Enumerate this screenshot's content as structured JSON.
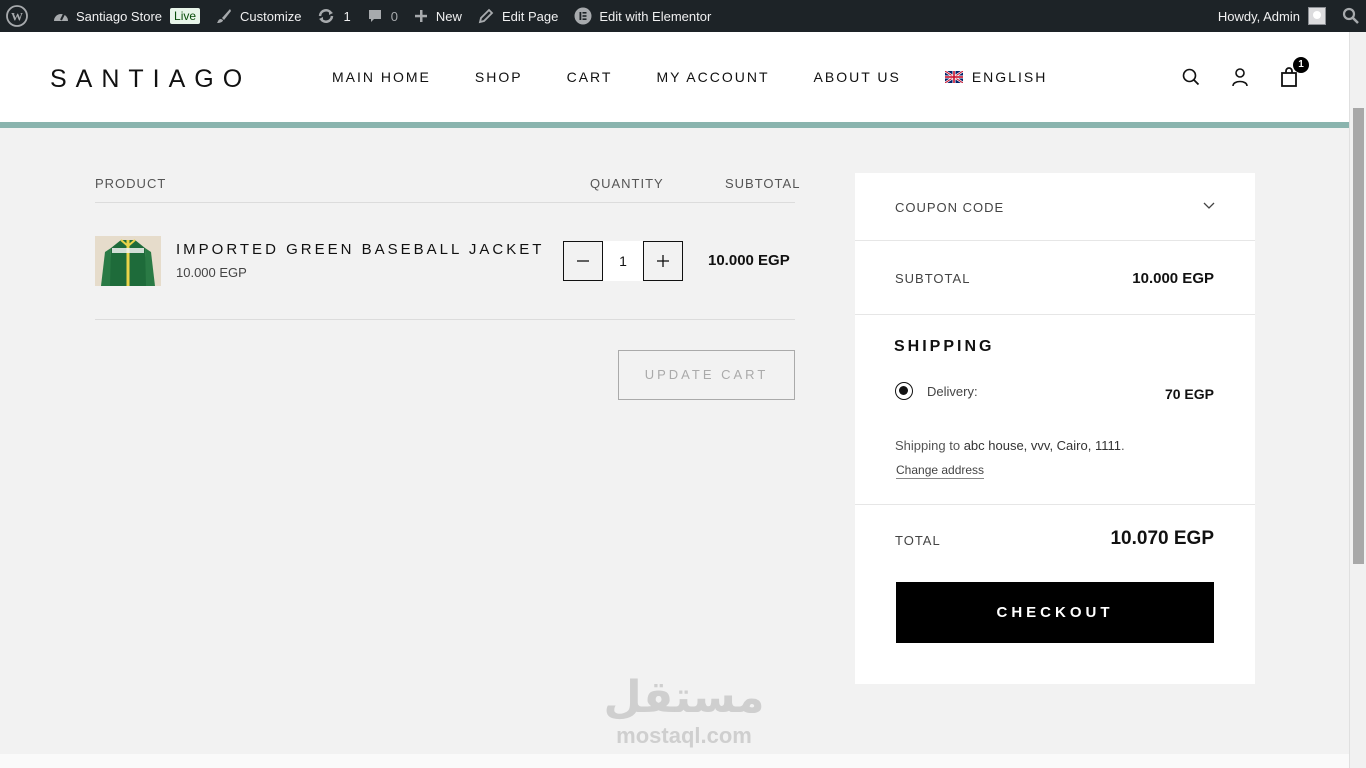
{
  "adminbar": {
    "site_name": "Santiago Store",
    "live_badge": "Live",
    "customize": "Customize",
    "updates_count": "1",
    "comments_count": "0",
    "new_label": "New",
    "edit_page": "Edit Page",
    "elementor": "Edit with Elementor",
    "howdy": "Howdy, Admin"
  },
  "header": {
    "logo": "SANTIAGO",
    "nav": [
      "MAIN HOME",
      "SHOP",
      "CART",
      "MY ACCOUNT",
      "ABOUT US"
    ],
    "language": "ENGLISH",
    "cart_count": "1",
    "accent_color": "#8ab4ae"
  },
  "cart": {
    "col_product": "PRODUCT",
    "col_quantity": "QUANTITY",
    "col_subtotal": "SUBTOTAL",
    "item": {
      "name": "IMPORTED GREEN BASEBALL JACKET",
      "price": "10.000 EGP",
      "quantity": "1",
      "subtotal": "10.000 EGP"
    },
    "update_button": "UPDATE CART"
  },
  "totals": {
    "coupon_label": "COUPON CODE",
    "subtotal_label": "SUBTOTAL",
    "subtotal_value": "10.000 EGP",
    "shipping_title": "SHIPPING",
    "delivery_label": "Delivery:",
    "delivery_value": "70 EGP",
    "shipping_to_prefix": "Shipping to",
    "shipping_address": "abc house, vvv, Cairo, 1111",
    "change_address": "Change address",
    "total_label": "TOTAL",
    "total_value": "10.070 EGP",
    "checkout_button": "CHECKOUT"
  },
  "watermark": {
    "arabic": "مستقل",
    "latin": "mostaql.com"
  }
}
